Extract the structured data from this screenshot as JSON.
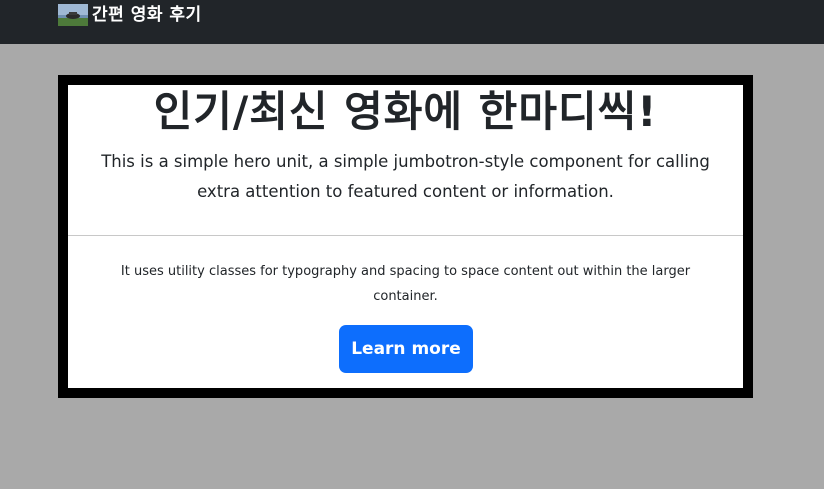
{
  "navbar": {
    "brand_text": "간편 영화 후기",
    "brand_logo_icon": "movie-thumbnail-logo"
  },
  "hero": {
    "title": "인기/최신 영화에 한마디씩!",
    "lead": "This is a simple hero unit, a simple jumbotron-style component for calling extra attention to featured content or information.",
    "body": "It uses utility classes for typography and spacing to space content out within the larger container.",
    "button_label": "Learn more"
  },
  "colors": {
    "navbar_bg": "#212529",
    "page_bg": "#a9a9a9",
    "hero_border": "#000000",
    "button_bg": "#0d6efd"
  }
}
